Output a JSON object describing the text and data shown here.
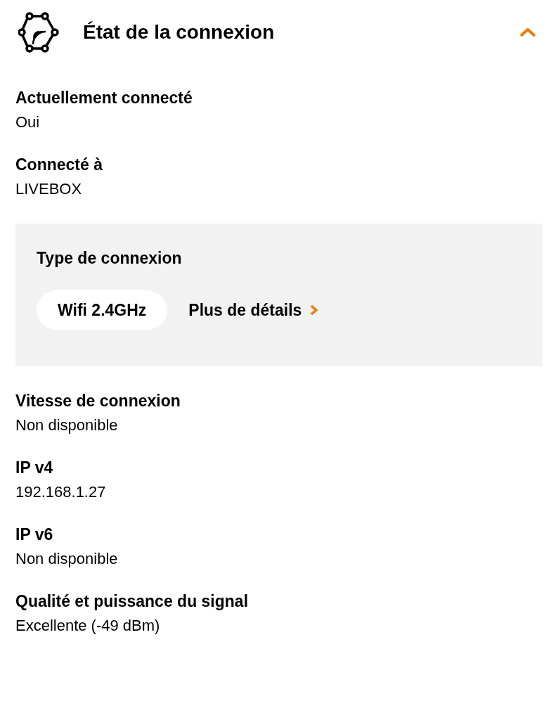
{
  "section": {
    "title": "État de la connexion",
    "expanded": true
  },
  "fields_top": [
    {
      "label": "Actuellement connecté",
      "value": "Oui"
    },
    {
      "label": "Connecté à",
      "value": "LIVEBOX"
    }
  ],
  "connection_type": {
    "label": "Type de connexion",
    "chip": "Wifi 2.4GHz",
    "link": "Plus de détails"
  },
  "fields_bottom": [
    {
      "label": "Vitesse de connexion",
      "value": "Non disponible"
    },
    {
      "label": "IP v4",
      "value": "192.168.1.27"
    },
    {
      "label": "IP v6",
      "value": "Non disponible"
    },
    {
      "label": "Qualité et puissance du signal",
      "value": "Excellente (-49 dBm)"
    }
  ]
}
